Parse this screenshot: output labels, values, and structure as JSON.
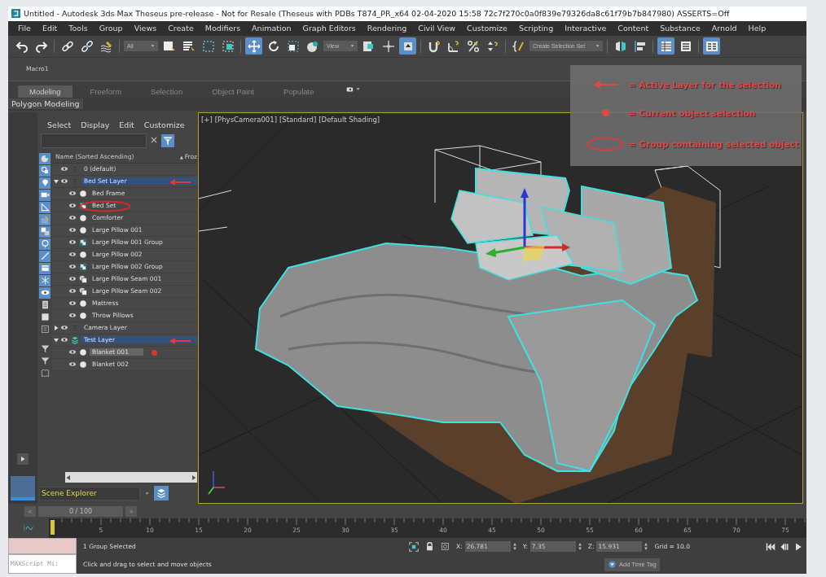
{
  "window": {
    "title": "Untitled - Autodesk 3ds Max Theseus pre-release - Not for Resale (Theseus with PDBs T874_PR_x64 02-04-2020 15:58 72c7f270c0a0f839e79326da8c61f79b7b847980) ASSERTS=Off"
  },
  "menu": [
    "File",
    "Edit",
    "Tools",
    "Group",
    "Views",
    "Create",
    "Modifiers",
    "Animation",
    "Graph Editors",
    "Rendering",
    "Civil View",
    "Customize",
    "Scripting",
    "Interactive",
    "Content",
    "Substance",
    "Arnold",
    "Help"
  ],
  "toolbar": [
    {
      "kind": "button",
      "selected": false
    },
    {
      "kind": "button",
      "selected": false
    },
    {
      "kind": "separator"
    },
    {
      "kind": "button",
      "selected": false
    },
    {
      "kind": "button",
      "selected": false
    },
    {
      "kind": "button",
      "selected": false
    },
    {
      "kind": "separator"
    },
    {
      "kind": "dropdown",
      "label": "All"
    },
    {
      "kind": "button",
      "selected": false
    },
    {
      "kind": "button",
      "selected": false
    },
    {
      "kind": "button",
      "selected": false
    },
    {
      "kind": "button",
      "selected": false
    },
    {
      "kind": "separator"
    },
    {
      "kind": "button",
      "selected": true
    },
    {
      "kind": "button",
      "selected": false
    },
    {
      "kind": "button",
      "selected": false
    },
    {
      "kind": "button",
      "selected": false
    },
    {
      "kind": "dropdown",
      "label": "View"
    },
    {
      "kind": "button",
      "selected": false
    },
    {
      "kind": "button",
      "selected": false
    },
    {
      "kind": "button",
      "selected": true
    },
    {
      "kind": "separator"
    },
    {
      "kind": "button",
      "selected": false
    },
    {
      "kind": "button",
      "selected": false
    },
    {
      "kind": "button",
      "selected": false
    },
    {
      "kind": "button",
      "selected": false
    },
    {
      "kind": "separator"
    },
    {
      "kind": "button",
      "selected": false
    },
    {
      "kind": "dropdown",
      "label": "Create Selection Set"
    },
    {
      "kind": "separator"
    },
    {
      "kind": "button",
      "selected": false
    },
    {
      "kind": "button",
      "selected": false
    },
    {
      "kind": "separator"
    },
    {
      "kind": "button",
      "selected": true
    },
    {
      "kind": "button",
      "selected": false
    },
    {
      "kind": "separator"
    },
    {
      "kind": "button",
      "selected": true
    }
  ],
  "macro_label": "Macro1",
  "ribbon_tabs": [
    {
      "label": "Modeling",
      "selected": true
    },
    {
      "label": "Freeform",
      "selected": false
    },
    {
      "label": "Selection",
      "selected": false
    },
    {
      "label": "Object Paint",
      "selected": false
    },
    {
      "label": "Populate",
      "selected": false
    }
  ],
  "ribbon_panel": "Polygon Modeling",
  "explorer": {
    "menu": [
      "Select",
      "Display",
      "Edit",
      "Customize"
    ],
    "columns": [
      "Name (Sorted Ascending)",
      "Froz"
    ],
    "sort_indicator": "▲",
    "filters": [
      {
        "on": true
      },
      {
        "on": true
      },
      {
        "on": true
      },
      {
        "on": true
      },
      {
        "on": true
      },
      {
        "on": true
      },
      {
        "on": true
      },
      {
        "on": true
      },
      {
        "on": true
      },
      {
        "on": true
      },
      {
        "on": true
      },
      {
        "on": true
      },
      {
        "on": false
      },
      {
        "on": false
      },
      {
        "on": false
      },
      {
        "on": false
      },
      {
        "on": false
      },
      {
        "on": false
      }
    ],
    "tree": [
      {
        "label": "0 (default)",
        "kind": "layer",
        "active": false,
        "selected": false
      },
      {
        "label": "Bed Set Layer",
        "kind": "layer",
        "expanded": true,
        "active": true,
        "selected": false,
        "annotation": {
          "kind": "arrow"
        },
        "children": [
          {
            "label": "Bed Frame",
            "kind": "object",
            "active": false,
            "selected": false
          },
          {
            "label": "Bed Set",
            "kind": "group",
            "active": false,
            "selected": false,
            "annotation": {
              "kind": "ellipse"
            }
          },
          {
            "label": "Comforter",
            "kind": "object",
            "active": false,
            "selected": false
          },
          {
            "label": "Large Pillow 001",
            "kind": "object",
            "active": false,
            "selected": false
          },
          {
            "label": "Large Pillow 001 Group",
            "kind": "group",
            "active": false,
            "selected": false
          },
          {
            "label": "Large Pillow 002",
            "kind": "object",
            "active": false,
            "selected": false
          },
          {
            "label": "Large Pillow 002 Group",
            "kind": "group",
            "active": false,
            "selected": false
          },
          {
            "label": "Large Pillow Seam 001",
            "kind": "seam",
            "active": false,
            "selected": false
          },
          {
            "label": "Large Pillow Seam 002",
            "kind": "seam",
            "active": false,
            "selected": false
          },
          {
            "label": "Mattress",
            "kind": "object",
            "active": false,
            "selected": false
          },
          {
            "label": "Throw Pillows",
            "kind": "object",
            "active": false,
            "selected": false
          }
        ]
      },
      {
        "label": "Camera Layer",
        "kind": "layer",
        "expanded": false,
        "active": false,
        "selected": false
      },
      {
        "label": "Test Layer",
        "kind": "current",
        "expanded": true,
        "active": true,
        "selected": false,
        "annotation": {
          "kind": "arrow"
        },
        "children": [
          {
            "label": "Blanket 001",
            "kind": "object",
            "active": false,
            "selected": true,
            "annotation": {
              "kind": "dot"
            }
          },
          {
            "label": "Blanket 002",
            "kind": "object",
            "active": false,
            "selected": false
          }
        ]
      }
    ],
    "name": "Scene Explorer"
  },
  "viewport": {
    "labels": [
      "[+]",
      "[PhysCamera001]",
      "[Standard]",
      "[Default Shading]"
    ]
  },
  "legend": [
    {
      "kind": "arrow",
      "text": "= Active Layer for the selection"
    },
    {
      "kind": "dot",
      "text": "= Current object selection"
    },
    {
      "kind": "ellipse",
      "text": "= Group containing selected object"
    }
  ],
  "time_slider": {
    "prev": "<",
    "position": "0 / 100",
    "next": ">"
  },
  "timeline": {
    "labels": [
      "5",
      "10",
      "15",
      "20",
      "25",
      "30",
      "35",
      "40",
      "45",
      "50",
      "55",
      "60",
      "65",
      "70",
      "75"
    ]
  },
  "status": {
    "listener": "MAXScript Mi:",
    "selection": "1 Group Selected",
    "prompt": "Click and drag to select and move objects",
    "coords": [
      {
        "axis": "X:",
        "value": "26.781"
      },
      {
        "axis": "Y:",
        "value": "7.35"
      },
      {
        "axis": "Z:",
        "value": "15.931"
      }
    ],
    "grid": "Grid = 10.0",
    "time_tag": "Add Time Tag"
  }
}
